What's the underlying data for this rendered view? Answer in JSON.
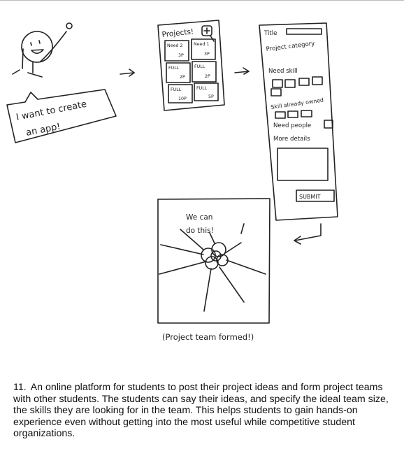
{
  "sketch": {
    "person": {
      "speech": [
        "I want to create",
        "an app!"
      ]
    },
    "projects_panel": {
      "title": "Projects!",
      "cards": [
        {
          "tag": "Need 2",
          "size": "3P"
        },
        {
          "tag": "Need 1",
          "size": "3P"
        },
        {
          "tag": "FULL",
          "size": "2P"
        },
        {
          "tag": "FULL",
          "size": "2P"
        },
        {
          "tag": "FULL",
          "size": "10P"
        },
        {
          "tag": "FULL",
          "size": "5P"
        }
      ]
    },
    "form": {
      "title_label": "Title",
      "category_label": "Project category",
      "need_skill_label": "Need skill",
      "owned_skill_label": "Skill already owned",
      "need_people_label": "Need people",
      "details_label": "More details",
      "submit_label": "SUBMIT"
    },
    "team_frame": {
      "exclaim": [
        "We can",
        "do this!"
      ],
      "caption": "(Project team formed!)"
    }
  },
  "caption": {
    "number": "11.",
    "text": "An online platform for students to post their project ideas and form project teams with other students. The students can say their ideas, and specify the ideal team size, the skills they are looking for in the team. This helps students to gain hands-on experience even without getting into the most useful while competitive student organizations."
  }
}
